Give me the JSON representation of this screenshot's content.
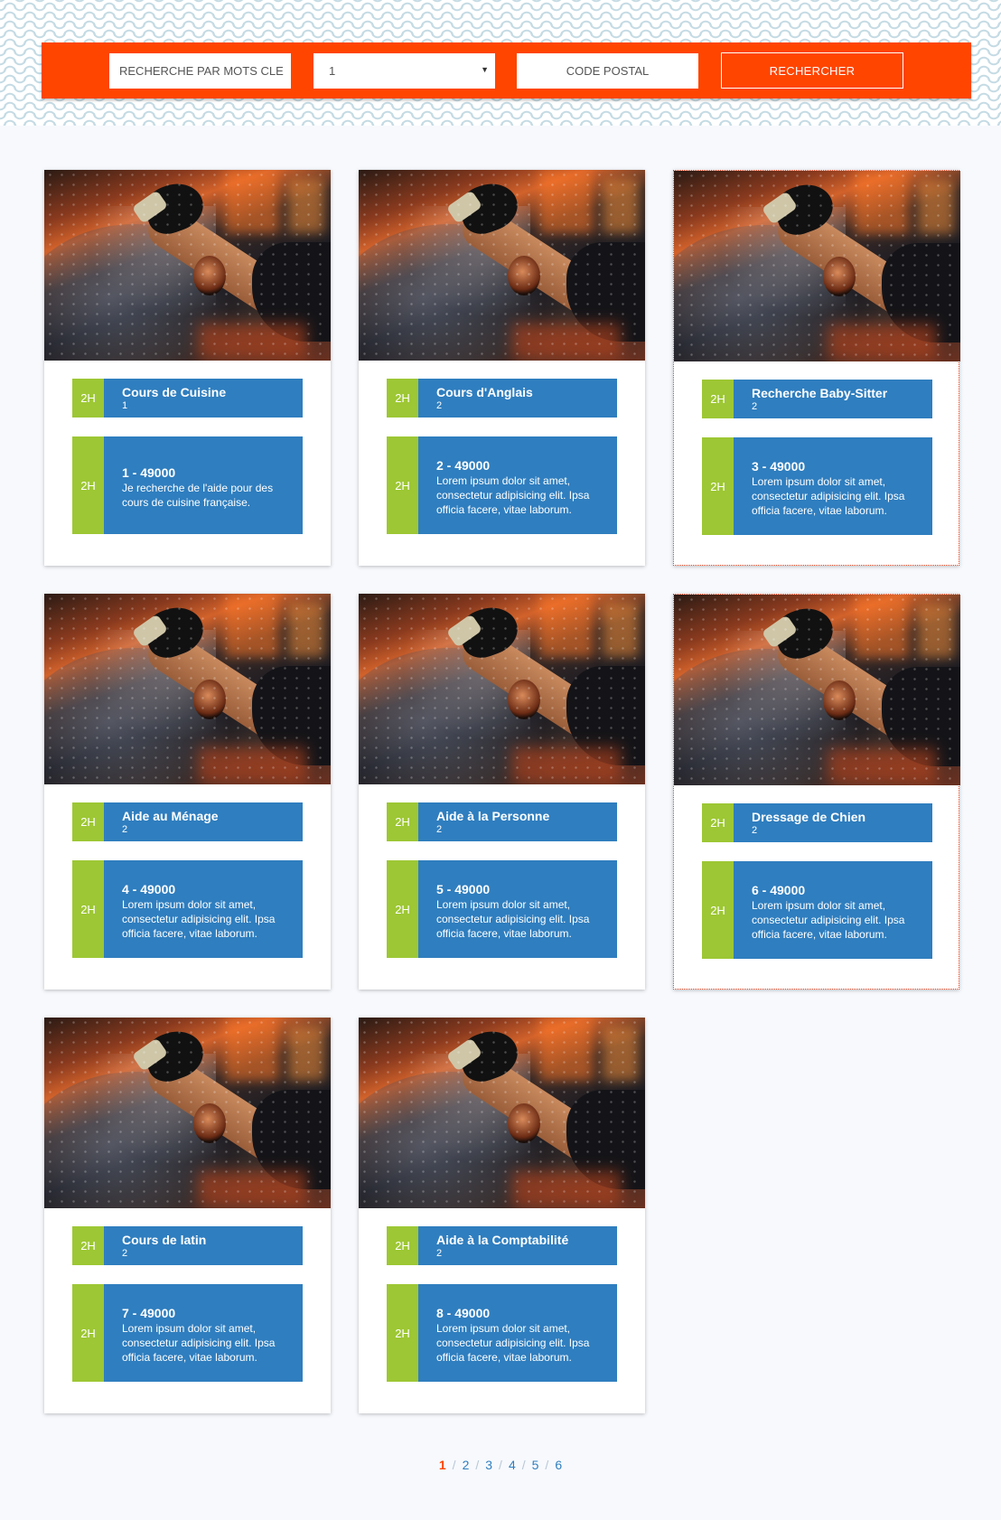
{
  "search": {
    "keywords_placeholder": "RECHERCHE PAR MOTS CLE",
    "category_value": "1",
    "postal_placeholder": "CODE POSTAL",
    "button_label": "RECHERCHER"
  },
  "cards": [
    {
      "tag": "2H",
      "title": "Cours de Cuisine",
      "sub": "1",
      "detail_title": "1 - 49000",
      "detail_desc": "Je recherche de l'aide pour des cours de cuisine française."
    },
    {
      "tag": "2H",
      "title": "Cours d'Anglais",
      "sub": "2",
      "detail_title": "2 - 49000",
      "detail_desc": "Lorem ipsum dolor sit amet, consectetur adipisicing elit. Ipsa officia facere, vitae laborum."
    },
    {
      "tag": "2H",
      "title": "Recherche Baby-Sitter",
      "sub": "2",
      "detail_title": "3 - 49000",
      "detail_desc": "Lorem ipsum dolor sit amet, consectetur adipisicing elit. Ipsa officia facere, vitae laborum."
    },
    {
      "tag": "2H",
      "title": "Aide au Ménage",
      "sub": "2",
      "detail_title": "4 - 49000",
      "detail_desc": "Lorem ipsum dolor sit amet, consectetur adipisicing elit. Ipsa officia facere, vitae laborum."
    },
    {
      "tag": "2H",
      "title": "Aide à la Personne",
      "sub": "2",
      "detail_title": "5 - 49000",
      "detail_desc": "Lorem ipsum dolor sit amet, consectetur adipisicing elit. Ipsa officia facere, vitae laborum."
    },
    {
      "tag": "2H",
      "title": "Dressage de Chien",
      "sub": "2",
      "detail_title": "6 - 49000",
      "detail_desc": "Lorem ipsum dolor sit amet, consectetur adipisicing elit. Ipsa officia facere, vitae laborum."
    },
    {
      "tag": "2H",
      "title": "Cours de latin",
      "sub": "2",
      "detail_title": "7 - 49000",
      "detail_desc": "Lorem ipsum dolor sit amet, consectetur adipisicing elit. Ipsa officia facere, vitae laborum."
    },
    {
      "tag": "2H",
      "title": "Aide à la Comptabilité",
      "sub": "2",
      "detail_title": "8 - 49000",
      "detail_desc": "Lorem ipsum dolor sit amet, consectetur adipisicing elit. Ipsa officia facere, vitae laborum."
    }
  ],
  "pagination": {
    "pages": [
      "1",
      "2",
      "3",
      "4",
      "5",
      "6"
    ],
    "separator": "/",
    "current": "1"
  },
  "colors": {
    "accent": "#ff4500",
    "card_blue": "#2f7ebf",
    "tag_green": "#9dc734"
  }
}
